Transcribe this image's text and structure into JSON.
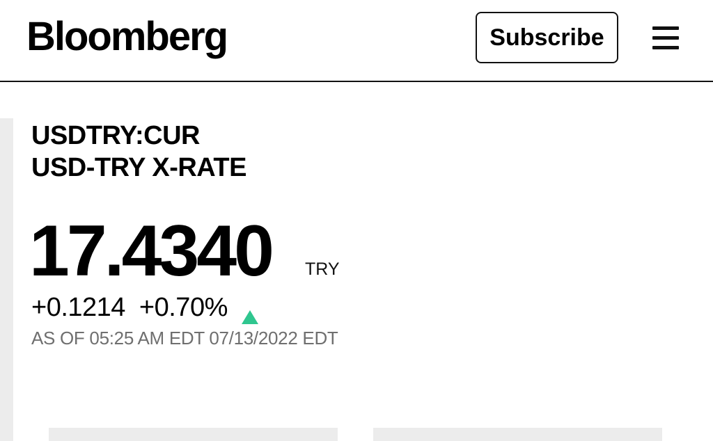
{
  "header": {
    "logo": "Bloomberg",
    "subscribe_label": "Subscribe",
    "menu_icon": "hamburger-menu-icon"
  },
  "quote": {
    "ticker": "USDTRY:CUR",
    "name": "USD-TRY X-RATE",
    "price": "17.4340",
    "currency": "TRY",
    "change_abs": "+0.1214",
    "change_pct": "+0.70%",
    "direction_icon": "triangle-up-icon",
    "direction_color": "#2fc68f",
    "timestamp": "AS OF 05:25 AM EDT 07/13/2022 EDT"
  },
  "colors": {
    "text": "#000000",
    "muted_text": "#6f6f6f",
    "rail": "#ececec",
    "up": "#2fc68f"
  }
}
